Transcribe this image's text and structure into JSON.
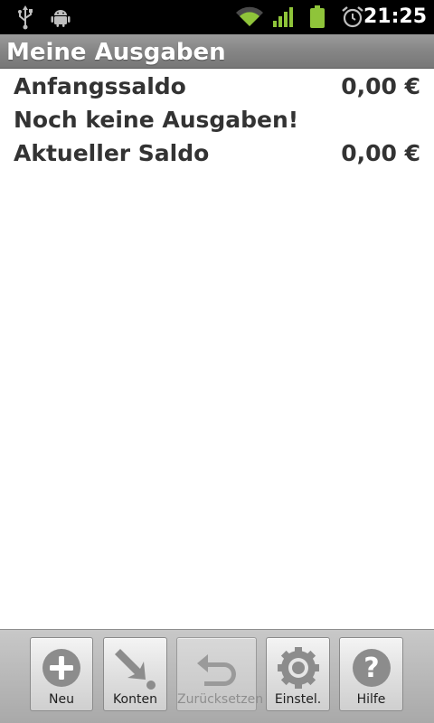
{
  "status_bar": {
    "time": "21:25",
    "icons": [
      "usb-icon",
      "android-debug-icon",
      "wifi-icon",
      "signal-icon",
      "battery-icon",
      "alarm-icon"
    ],
    "colors": {
      "background": "#000000",
      "accent": "#9acd32"
    }
  },
  "app": {
    "title": "Meine Ausgaben"
  },
  "summary": {
    "opening_label": "Anfangssaldo",
    "opening_value": "0,00 €",
    "empty_message": "Noch keine Ausgaben!",
    "current_label": "Aktueller Saldo",
    "current_value": "0,00 €"
  },
  "toolbar": {
    "buttons": [
      {
        "label": "Neu",
        "icon": "plus-circle-icon",
        "enabled": true
      },
      {
        "label": "Konten",
        "icon": "arrow-to-dot-icon",
        "enabled": true
      },
      {
        "label": "Zurücksetzen",
        "icon": "undo-arrow-icon",
        "enabled": false
      },
      {
        "label": "Einstel.",
        "icon": "gear-icon",
        "enabled": true
      },
      {
        "label": "Hilfe",
        "icon": "help-icon",
        "enabled": true
      }
    ]
  }
}
